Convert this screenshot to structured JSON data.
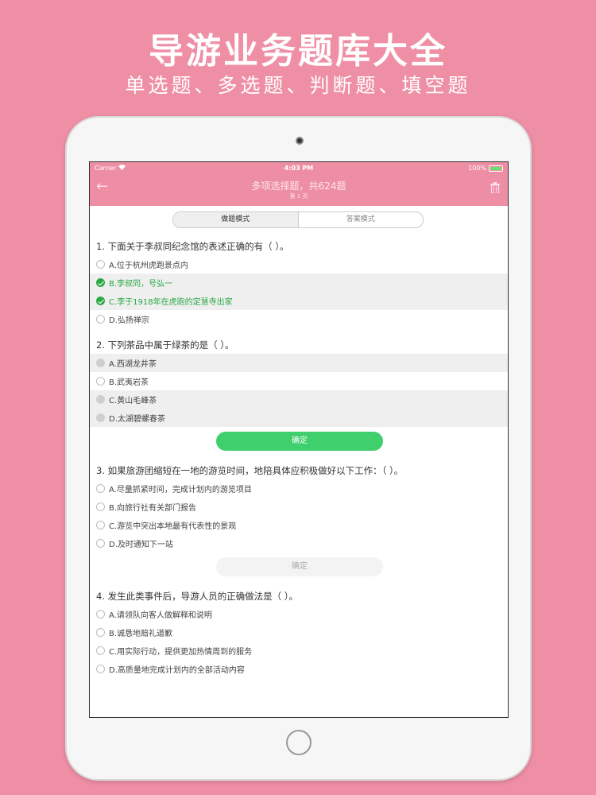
{
  "banner": {
    "title": "导游业务题库大全",
    "subtitle": "单选题、多选题、判断题、填空题"
  },
  "status_bar": {
    "carrier": "Carrier",
    "time": "4:03 PM",
    "battery": "100%"
  },
  "nav": {
    "title": "多项选择题，共624题",
    "subtitle": "第 1 页"
  },
  "segments": {
    "practice": "做题模式",
    "answer": "答案模式"
  },
  "questions": [
    {
      "title": "1. 下面关于李叔同纪念馆的表述正确的有（   ）。",
      "options": [
        "A.位于杭州虎跑景点内",
        "B.李叔同，号弘一",
        "C.李于1918年在虎跑的定慧寺出家",
        "D.弘扬禅宗"
      ]
    },
    {
      "title": "2. 下列茶品中属于绿茶的是（   ）。",
      "options": [
        "A.西湖龙井茶",
        "B.武夷岩茶",
        "C.黄山毛峰茶",
        "D.太湖碧螺春茶"
      ],
      "confirm": "确定"
    },
    {
      "title": "3. 如果旅游团缩短在一地的游览时间，地陪具体应积极做好以下工作：（   ）。",
      "options": [
        "A.尽量抓紧时间，完成计划内的游览项目",
        "B.向旅行社有关部门报告",
        "C.游览中突出本地最有代表性的景观",
        "D.及时通知下一站"
      ],
      "confirm": "确定"
    },
    {
      "title": "4. 发生此类事件后，导游人员的正确做法是（   ）。",
      "options": [
        "A.请领队向客人做解释和说明",
        "B.诚恳地赔礼道歉",
        "C.用实际行动，提供更加热情周到的服务",
        "D.高质量地完成计划内的全部活动内容"
      ]
    }
  ],
  "colors": {
    "accent": "#ee8ea4",
    "correct": "#2aa844",
    "button": "#3fcf6c",
    "background": "#ef8fa5"
  },
  "icons": {
    "back": "arrow-left-icon",
    "trash": "trash-icon",
    "wifi": "wifi-icon",
    "check": "check-circle-icon"
  }
}
